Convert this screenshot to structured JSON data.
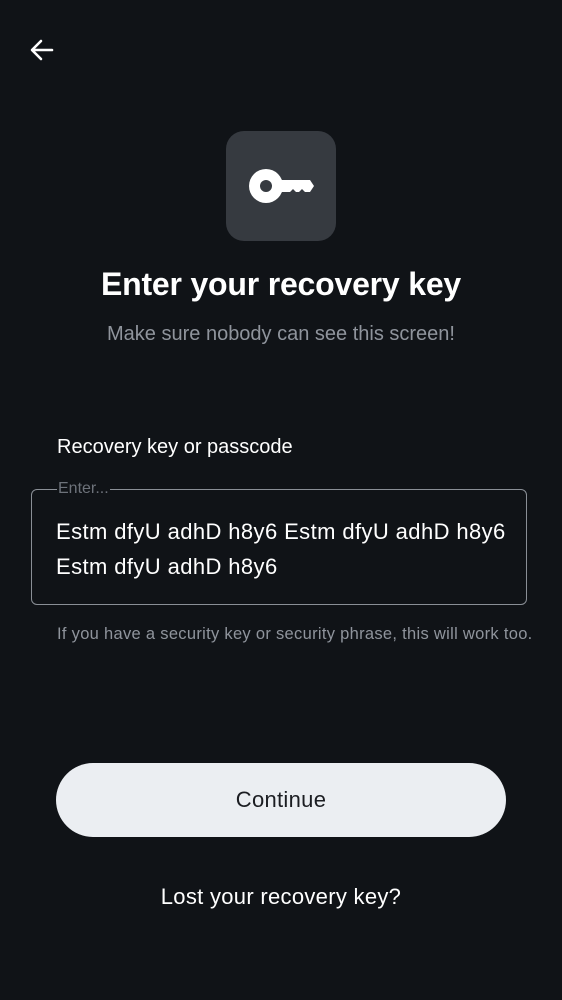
{
  "header": {
    "back_icon": "arrow-left-icon"
  },
  "hero": {
    "icon": "key-icon",
    "title": "Enter your recovery key",
    "subtitle": "Make sure nobody can see this screen!"
  },
  "form": {
    "label": "Recovery key or passcode",
    "placeholder": "Enter...",
    "value": "Estm dfyU adhD h8y6 Estm dfyU adhD h8y6 Estm dfyU adhD h8y6",
    "hint": "If you have a security key or security phrase, this will work too."
  },
  "actions": {
    "continue_label": "Continue",
    "lost_key_label": "Lost your recovery key?"
  },
  "colors": {
    "background": "#101317",
    "tile": "#363a40",
    "button": "#ebeef2",
    "muted_text": "#8f949c"
  }
}
